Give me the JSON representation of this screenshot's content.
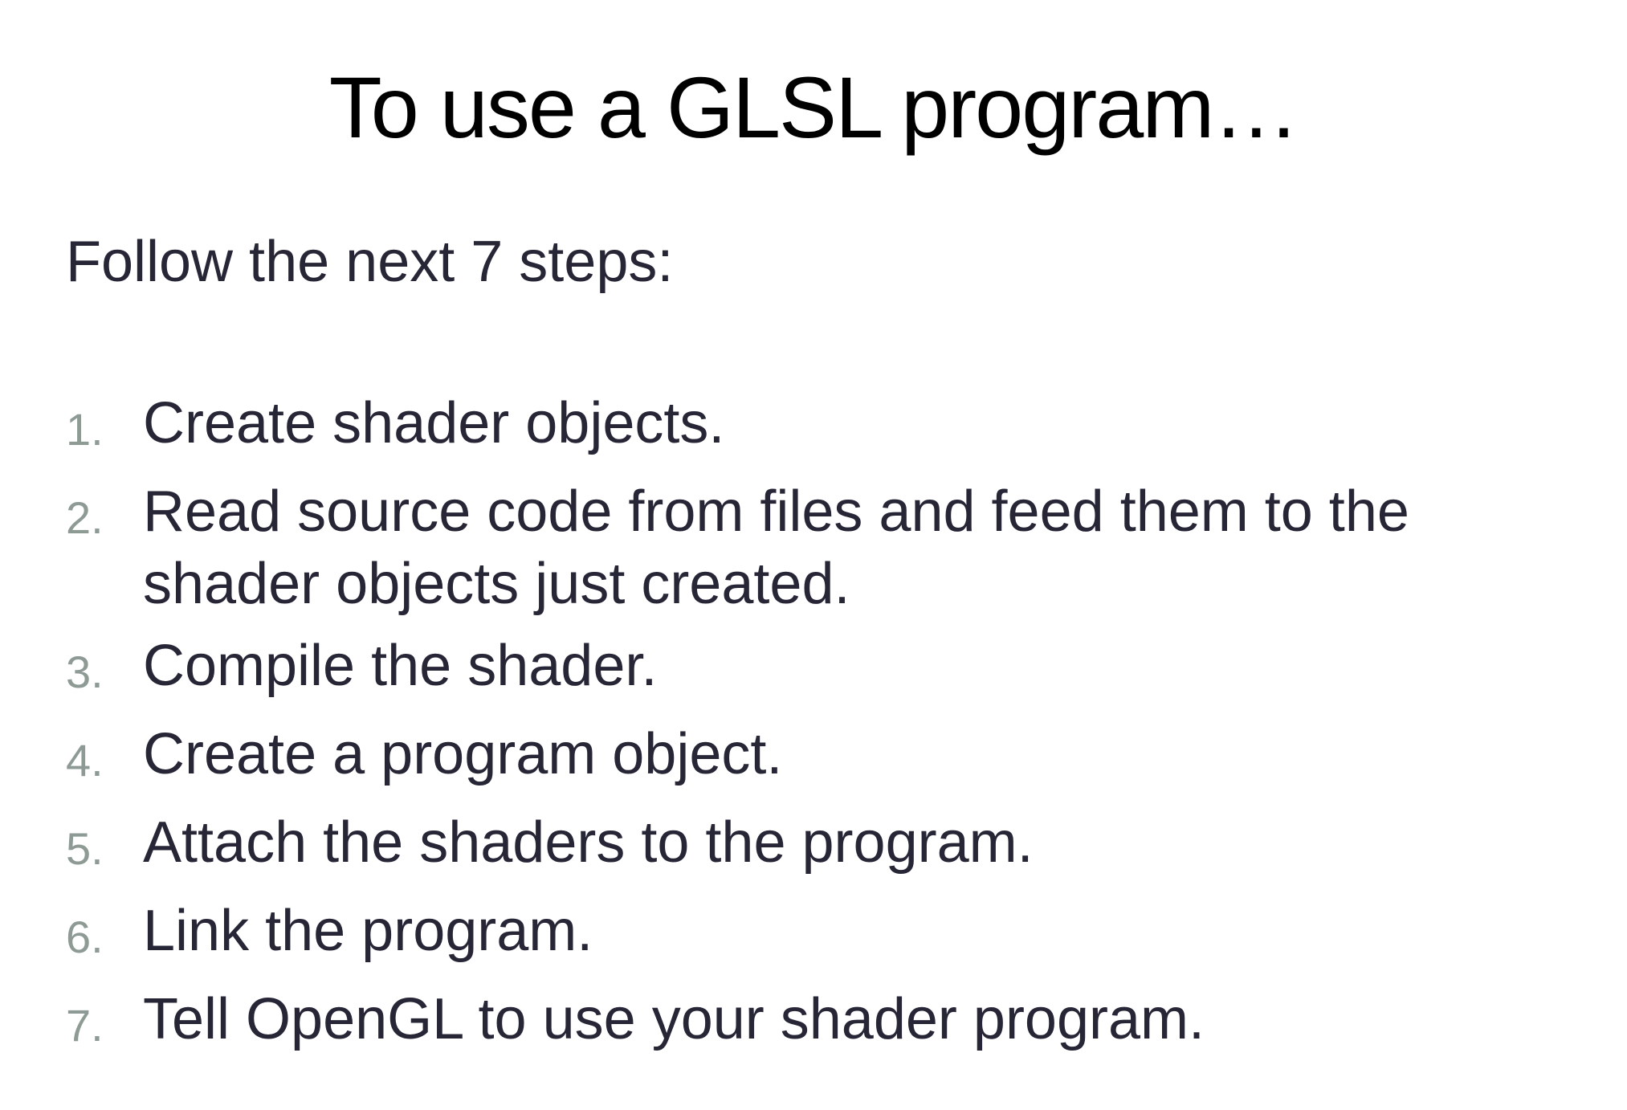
{
  "slide": {
    "title": "To use a GLSL program…",
    "intro": "Follow the next 7 steps:",
    "steps": [
      {
        "num": "1.",
        "text": "Create shader objects."
      },
      {
        "num": "2.",
        "text": "Read source code from files and feed them to the shader objects just created."
      },
      {
        "num": "3.",
        "text": "Compile the shader."
      },
      {
        "num": "4.",
        "text": "Create a program object."
      },
      {
        "num": "5.",
        "text": "Attach the shaders to the program."
      },
      {
        "num": "6.",
        "text": "Link the program."
      },
      {
        "num": "7.",
        "text": "Tell OpenGL to use your shader program."
      }
    ]
  },
  "colors": {
    "title": "#000000",
    "body_text": "#262636",
    "number": "#8e9a94",
    "background": "#ffffff"
  }
}
